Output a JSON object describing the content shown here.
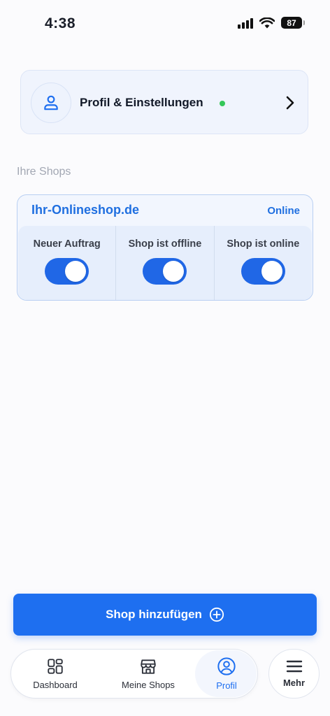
{
  "status_bar": {
    "time": "4:38",
    "battery": "87"
  },
  "profile": {
    "title": "Profil & Einstellungen",
    "status_color": "#34c759"
  },
  "shops_section": {
    "label": "Ihre Shops"
  },
  "shop": {
    "name": "Ihr-Onlineshop.de",
    "status": "Online",
    "toggles": [
      {
        "label": "Neuer Auftrag",
        "on": true
      },
      {
        "label": "Shop ist offline",
        "on": true
      },
      {
        "label": "Shop ist online",
        "on": true
      }
    ]
  },
  "actions": {
    "add_shop_label": "Shop hinzufügen"
  },
  "bottom_nav": {
    "items": [
      {
        "label": "Dashboard",
        "icon": "dashboard-icon",
        "active": false
      },
      {
        "label": "Meine Shops",
        "icon": "store-icon",
        "active": false
      },
      {
        "label": "Profil",
        "icon": "profile-icon",
        "active": true
      }
    ],
    "more_label": "Mehr"
  },
  "colors": {
    "accent": "#1e6ff0",
    "toggle_on": "#2067e6",
    "online": "#34c759"
  }
}
